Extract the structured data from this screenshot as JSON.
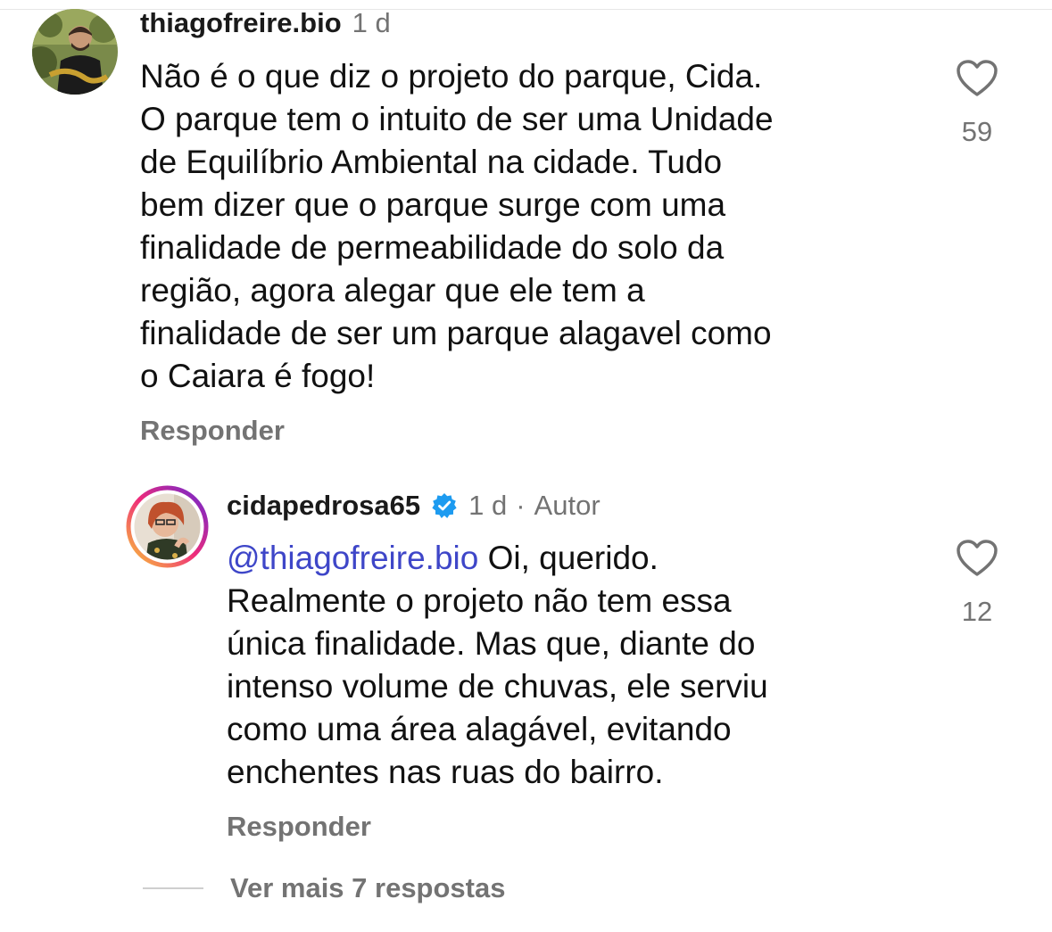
{
  "comments": [
    {
      "username": "thiagofreire.bio",
      "time": "1 d",
      "text": "Não é o que diz o projeto do parque, Cida.\nO parque tem o intuito de ser uma Unidade\nde Equilíbrio Ambiental na cidade. Tudo\nbem dizer que o parque surge com uma\nfinalidade de permeabilidade do solo da\nregião, agora alegar que ele tem a\nfinalidade de ser um parque alagavel como\no Caiara é fogo!",
      "likes": "59",
      "reply_label": "Responder"
    },
    {
      "username": "cidapedrosa65",
      "verified": true,
      "time": "1 d",
      "separator": "·",
      "author_tag": "Autor",
      "mention": "@thiagofreire.bio",
      "text": " Oi, querido.\nRealmente o projeto não tem essa\núnica finalidade. Mas que, diante do\nintenso volume de chuvas, ele serviu\ncomo uma área alagável, evitando\nenchentes nas ruas do bairro.",
      "likes": "12",
      "reply_label": "Responder"
    }
  ],
  "more_replies_label": "Ver mais 7 respostas",
  "colors": {
    "mention": "#3e46c8",
    "secondary_text": "#737373",
    "verified_badge": "#1d9bf0",
    "story_ring_start": "#f9ce34",
    "story_ring_mid": "#ee2a7b",
    "story_ring_end": "#6228d7"
  },
  "icons": {
    "like": "heart-outline-icon",
    "verified": "verified-badge-icon"
  }
}
